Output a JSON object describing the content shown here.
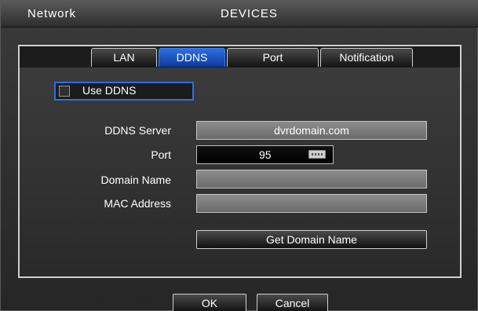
{
  "header": {
    "section": "Network",
    "title": "DEVICES"
  },
  "tabs": [
    {
      "label": "LAN",
      "active": false
    },
    {
      "label": "DDNS",
      "active": true
    },
    {
      "label": "Port",
      "active": false
    },
    {
      "label": "Notification",
      "active": false
    }
  ],
  "ddns": {
    "use_label": "Use DDNS",
    "use_checked": false,
    "server_label": "DDNS Server",
    "server_value": "dvrdomain.com",
    "port_label": "Port",
    "port_value": "95",
    "domain_label": "Domain Name",
    "domain_value": "",
    "mac_label": "MAC Address",
    "mac_value": "",
    "get_domain_button": "Get Domain Name"
  },
  "footer": {
    "ok": "OK",
    "cancel": "Cancel"
  },
  "colors": {
    "accent": "#2b6fe8",
    "background": "#2b2b2b"
  }
}
